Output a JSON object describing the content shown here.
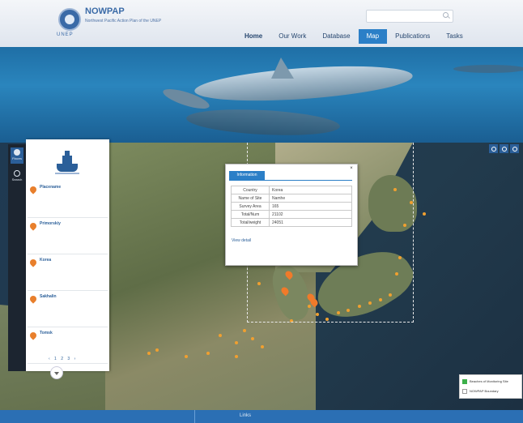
{
  "header": {
    "org_title": "NOWPAP",
    "org_subtitle": "Northwest Pacific Action Plan of the UNEP",
    "unep_label": "UNEP",
    "search_placeholder": "",
    "nav": [
      {
        "label": "Home"
      },
      {
        "label": "Our Work"
      },
      {
        "label": "Database"
      },
      {
        "label": "Map"
      },
      {
        "label": "Publications"
      },
      {
        "label": "Tasks"
      }
    ]
  },
  "map": {
    "tools_left": [
      {
        "label": "Places"
      },
      {
        "label": "Search"
      }
    ],
    "panel_items": [
      {
        "name": "Placename",
        "line1": "",
        "line2": "",
        "line3": ""
      },
      {
        "name": "Primorskiy",
        "line1": "",
        "line2": "",
        "line3": ""
      },
      {
        "name": "Korea",
        "line1": "",
        "line2": "",
        "line3": ""
      },
      {
        "name": "Sakhalin",
        "line1": "",
        "line2": "",
        "line3": ""
      },
      {
        "name": "Tomsk",
        "line1": "",
        "line2": "",
        "line3": ""
      }
    ],
    "pager": "‹ 1 2 3 ›",
    "popup": {
      "tab_label": "Information",
      "rows": [
        {
          "key": "Country",
          "value": "Korea"
        },
        {
          "key": "Name of Site",
          "value": "Namhe"
        },
        {
          "key": "Survey Area",
          "value": "165"
        },
        {
          "key": "Total/Num",
          "value": "21102"
        },
        {
          "key": "Total/weight",
          "value": "24051"
        }
      ],
      "link": "View detail"
    },
    "legend": [
      {
        "label": "Beaches of Monitoring Site",
        "color": "#3cb04a"
      },
      {
        "label": "NOWPAP Boundary",
        "color": "#ffffff"
      }
    ]
  },
  "footer": {
    "left": "",
    "right": "Links"
  },
  "colors": {
    "accent": "#2b7fc7",
    "marker": "#f0a030",
    "footer": "#2b6fb4"
  }
}
